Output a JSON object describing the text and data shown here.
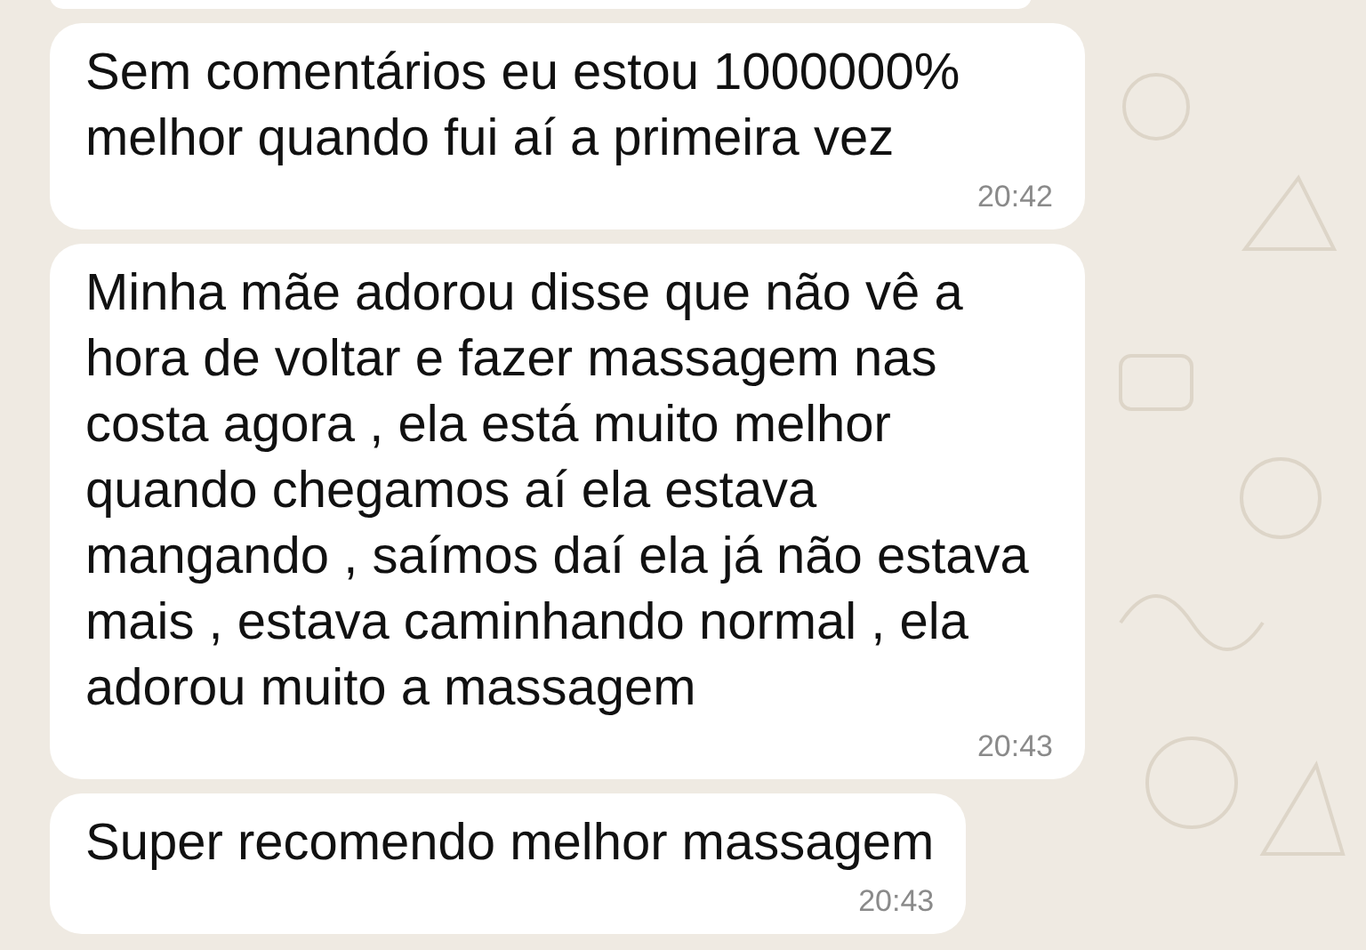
{
  "messages": [
    {
      "text": "Sem comentários eu estou 1000000% melhor quando fui aí a primeira vez",
      "time": "20:42"
    },
    {
      "text": "Minha mãe adorou disse que não vê a hora de voltar e fazer massagem nas costa agora , ela está muito melhor quando chegamos aí ela estava mangando , saímos daí ela já não estava mais , estava caminhando normal , ela adorou muito a massagem",
      "time": "20:43"
    },
    {
      "text": "Super recomendo melhor massagem",
      "time": "20:43"
    }
  ]
}
